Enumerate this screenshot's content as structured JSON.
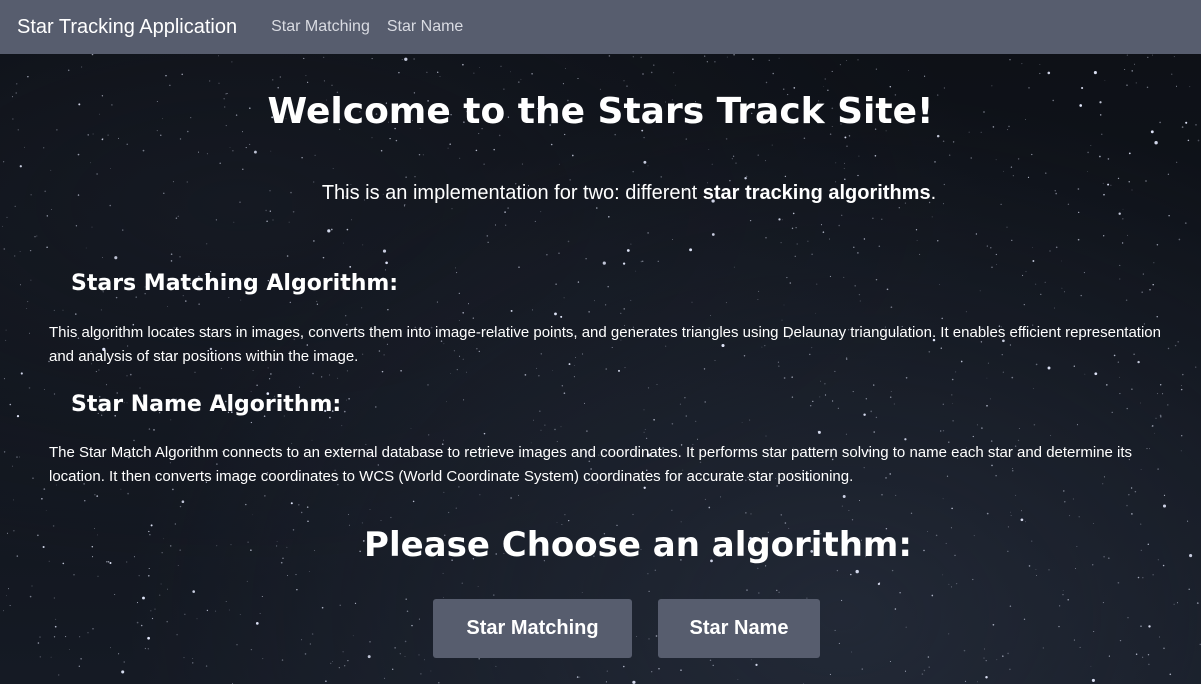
{
  "navbar": {
    "brand": "Star Tracking Application",
    "links": [
      {
        "label": "Star Matching"
      },
      {
        "label": "Star Name"
      }
    ]
  },
  "main": {
    "title": "Welcome to the Stars Track Site!",
    "intro_prefix": "This is an implementation for two: different ",
    "intro_bold": "star tracking algorithms",
    "intro_suffix": ".",
    "sections": [
      {
        "heading": "Stars Matching Algorithm:",
        "text": "This algorithm locates stars in images, converts them into image-relative points, and generates triangles using Delaunay triangulation. It enables efficient representation and analysis of star positions within the image."
      },
      {
        "heading": "Star Name Algorithm:",
        "text": "The Star Match Algorithm connects to an external database to retrieve images and coordinates. It performs star pattern solving to name each star and determine its location. It then converts image coordinates to WCS (World Coordinate System) coordinates for accurate star positioning."
      }
    ],
    "choose_heading": "Please Choose an algorithm:",
    "buttons": [
      {
        "label": "Star Matching"
      },
      {
        "label": "Star Name"
      }
    ]
  },
  "colors": {
    "navbar_bg": "#575d6e",
    "button_bg": "#575d6e",
    "text": "#ffffff",
    "background": "#0d1016"
  }
}
